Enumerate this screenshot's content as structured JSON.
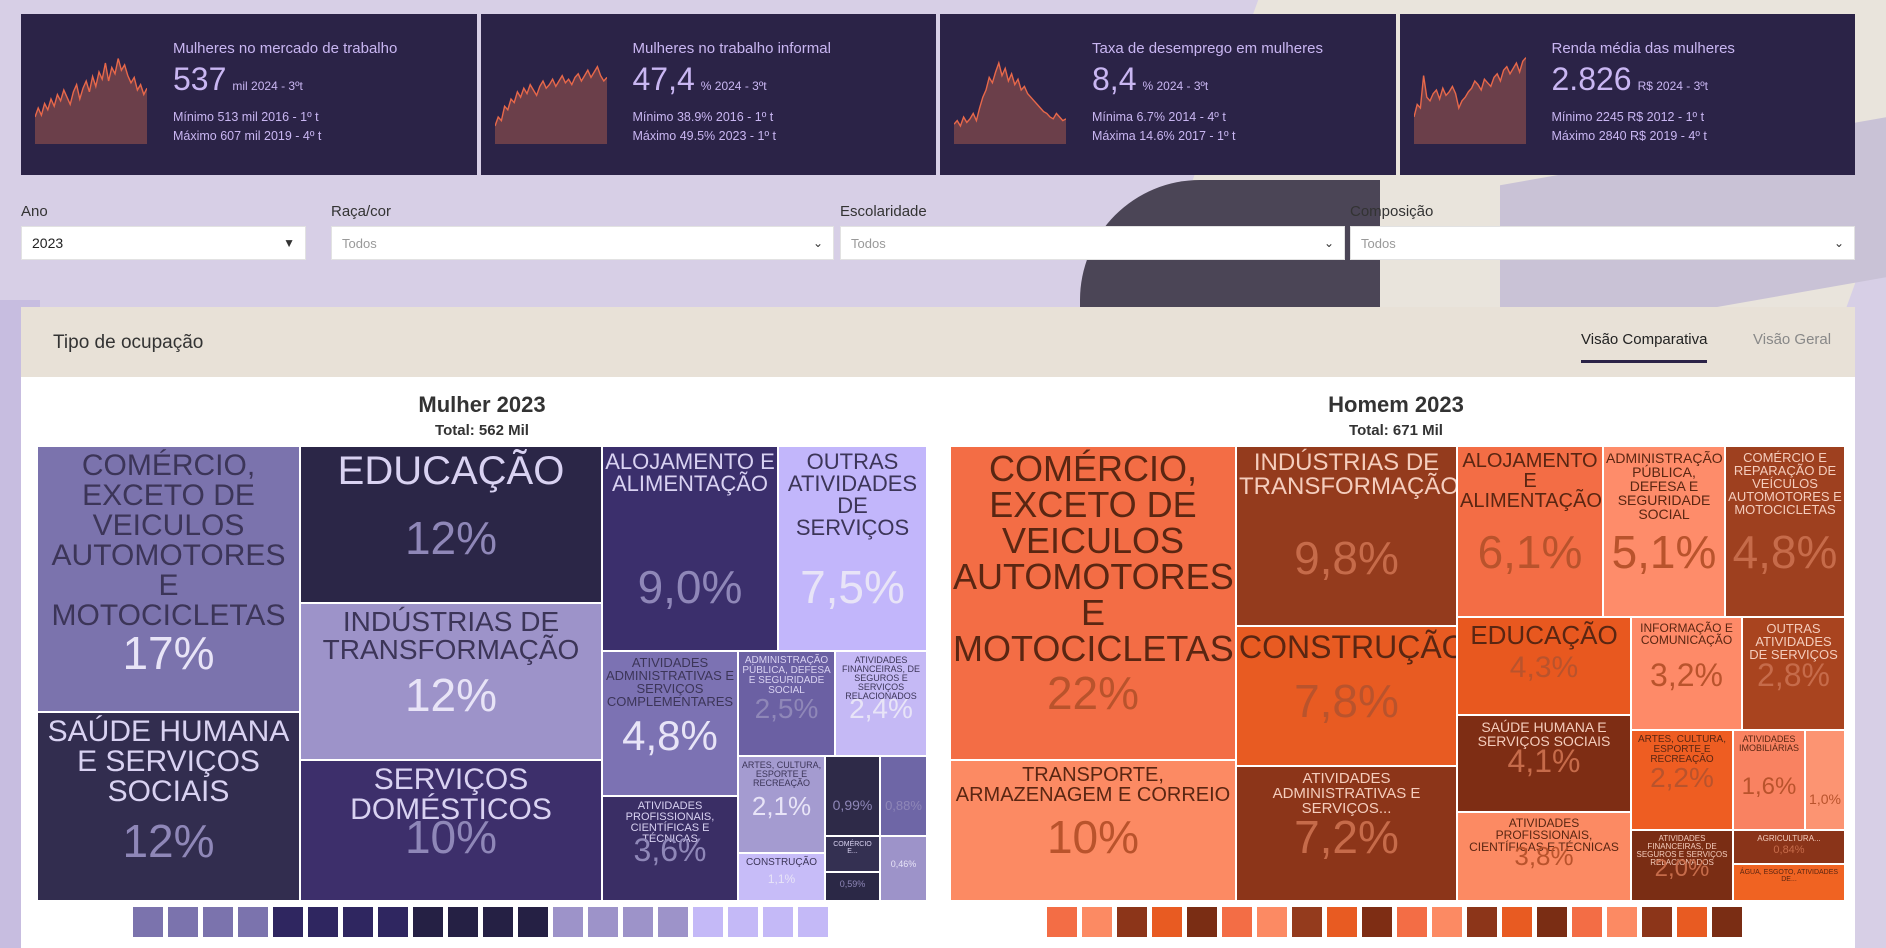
{
  "kpis": [
    {
      "title": "Mulheres no mercado de trabalho",
      "value": "537",
      "unit": "mil 2024 - 3ºt",
      "min": "Mínimo 513 mil 2016 - 1º t",
      "max": "Máximo 607 mil 2019 - 4º t",
      "spark": [
        30,
        40,
        32,
        45,
        38,
        50,
        42,
        55,
        48,
        60,
        52,
        44,
        58,
        66,
        50,
        62,
        70,
        58,
        75,
        64,
        80,
        72,
        90,
        70,
        85,
        78,
        95,
        82,
        88,
        76,
        68,
        74,
        60,
        66,
        55,
        62
      ]
    },
    {
      "title": "Mulheres no trabalho informal",
      "value": "47,4",
      "unit": "% 2024 - 3ºt",
      "min": "Mínimo 38.9% 2016 - 1º t",
      "max": "Máximo 49.5% 2023 - 1º t",
      "spark": [
        20,
        30,
        26,
        42,
        38,
        50,
        46,
        58,
        52,
        62,
        56,
        66,
        60,
        54,
        64,
        70,
        62,
        66,
        72,
        64,
        70,
        76,
        68,
        72,
        66,
        74,
        78,
        70,
        76,
        82,
        74,
        80,
        86,
        76,
        70,
        74
      ]
    },
    {
      "title": "Taxa de desemprego em mulheres",
      "value": "8,4",
      "unit": "% 2024 - 3ºt",
      "min": "Mínima 6.7% 2014 - 4º t",
      "max": "Máxima 14.6% 2017 - 1º t",
      "spark": [
        22,
        26,
        20,
        30,
        24,
        28,
        34,
        26,
        40,
        52,
        60,
        74,
        68,
        80,
        90,
        76,
        84,
        70,
        78,
        66,
        72,
        60,
        64,
        56,
        52,
        48,
        44,
        40,
        36,
        34,
        30,
        28,
        34,
        30,
        26,
        28
      ]
    },
    {
      "title": "Renda média das mulheres",
      "value": "2.826",
      "unit": "R$ 2024 - 3ºt",
      "min": "Mínimo 2245 R$ 2012 - 1º t",
      "max": "Máximo 2840 R$ 2019 - 4º t",
      "spark": [
        30,
        44,
        40,
        76,
        52,
        48,
        56,
        60,
        50,
        62,
        54,
        58,
        64,
        56,
        40,
        48,
        52,
        58,
        62,
        70,
        66,
        60,
        72,
        68,
        64,
        74,
        78,
        70,
        82,
        86,
        78,
        84,
        90,
        80,
        92,
        96
      ]
    }
  ],
  "filters": {
    "ano": {
      "label": "Ano",
      "value": "2023"
    },
    "raca": {
      "label": "Raça/cor",
      "placeholder": "Todos"
    },
    "escolaridade": {
      "label": "Escolaridade",
      "placeholder": "Todos"
    },
    "composicao": {
      "label": "Composição",
      "placeholder": "Todos"
    }
  },
  "panel": {
    "title": "Tipo de ocupação",
    "tabs": [
      {
        "label": "Visão Comparativa",
        "active": true
      },
      {
        "label": "Visão Geral",
        "active": false
      }
    ]
  },
  "charts": {
    "mulher": {
      "title": "Mulher 2023",
      "subtitle": "Total: 562 Mil"
    },
    "homem": {
      "title": "Homem 2023",
      "subtitle": "Total: 671 Mil"
    }
  },
  "chart_data": [
    {
      "type": "treemap",
      "title": "Mulher 2023",
      "subtitle": "Total: 562 Mil",
      "items": [
        {
          "label": "Comércio, exceto de veiculos automotores e motocicletas",
          "pct": "17%",
          "color": "#7b73ad"
        },
        {
          "label": "Saúde humana e serviços sociais",
          "pct": "12%",
          "color": "#322d4f"
        },
        {
          "label": "Educação",
          "pct": "12%",
          "color": "#2b2647"
        },
        {
          "label": "Indústrias de transformação",
          "pct": "12%",
          "color": "#9d93c9"
        },
        {
          "label": "Serviços domésticos",
          "pct": "10%",
          "color": "#3d2f6b"
        },
        {
          "label": "Alojamento e alimentação",
          "pct": "9,0%",
          "color": "#3b2f6c"
        },
        {
          "label": "Outras atividades de serviços",
          "pct": "7,5%",
          "color": "#c2b6fb"
        },
        {
          "label": "Atividades administrativas e serviços complementares",
          "pct": "4,8%",
          "color": "#7c72b3"
        },
        {
          "label": "Administração pública, defesa e seguridade social",
          "pct": "2,5%",
          "color": "#6b60a3"
        },
        {
          "label": "Atividades financeiras, de seguros e serviços relacionados",
          "pct": "2,4%",
          "color": "#c5b9f5"
        },
        {
          "label": "Atividades profissionais, científicas e técnicas",
          "pct": "3,6%",
          "color": "#3a2e65"
        },
        {
          "label": "Artes, cultura, esporte e recreação",
          "pct": "2,1%",
          "color": "#a49bd0"
        },
        {
          "label": "Construção",
          "pct": "1,1%",
          "color": "#c7bcf8"
        },
        {
          "label": "",
          "pct": "0,99%",
          "color": "#2e2a48"
        },
        {
          "label": "",
          "pct": "0,88%",
          "color": "#6e66a6"
        },
        {
          "label": "Comércio e...",
          "pct": "",
          "color": "#343052"
        },
        {
          "label": "",
          "pct": "0,59%",
          "color": "#2b2846"
        },
        {
          "label": "",
          "pct": "0,46%",
          "color": "#9d93c9"
        }
      ]
    },
    {
      "type": "treemap",
      "title": "Homem 2023",
      "subtitle": "Total: 671 Mil",
      "items": [
        {
          "label": "Comércio, exceto de veiculos automotores e motocicletas",
          "pct": "22%",
          "color": "#f36d45"
        },
        {
          "label": "Transporte, armazenagem e correio",
          "pct": "10%",
          "color": "#fc8a63"
        },
        {
          "label": "Indústrias de transformação",
          "pct": "9,8%",
          "color": "#943b1d"
        },
        {
          "label": "Construção",
          "pct": "7,8%",
          "color": "#e85b22"
        },
        {
          "label": "Atividades administrativas e serviços...",
          "pct": "7,2%",
          "color": "#8c3519"
        },
        {
          "label": "Alojamento e alimentação",
          "pct": "6,1%",
          "color": "#f36d45"
        },
        {
          "label": "Administração pública, defesa e seguridade social",
          "pct": "5,1%",
          "color": "#fe8c6a"
        },
        {
          "label": "Comércio e reparação de veículos automotores e motocicletas",
          "pct": "4,8%",
          "color": "#9e401f"
        },
        {
          "label": "Educação",
          "pct": "4,3%",
          "color": "#e8581f"
        },
        {
          "label": "Informação e comunicação",
          "pct": "3,2%",
          "color": "#fe8a68"
        },
        {
          "label": "Outras atividades de serviços",
          "pct": "2,8%",
          "color": "#a9441f"
        },
        {
          "label": "Saúde humana e serviços sociais",
          "pct": "4,1%",
          "color": "#7e2d14"
        },
        {
          "label": "Atividades profissionais, científicas e técnicas",
          "pct": "3,8%",
          "color": "#fc8a63"
        },
        {
          "label": "Artes, cultura, esporte e recreação",
          "pct": "2,2%",
          "color": "#ee5d22"
        },
        {
          "label": "Atividades imobiliárias",
          "pct": "1,6%",
          "color": "#f98261"
        },
        {
          "label": "",
          "pct": "1,0%",
          "color": "#fc9472"
        },
        {
          "label": "Atividades financeiras, de seguros e serviços relacionados",
          "pct": "2,0%",
          "color": "#7a2d14"
        },
        {
          "label": "Agricultura...",
          "pct": "0,84%",
          "color": "#8a3419"
        },
        {
          "label": "Água, esgoto, atividades de...",
          "pct": "",
          "color": "#f06322"
        }
      ]
    }
  ],
  "legends": {
    "mulher": [
      "#7b73ad",
      "#7b73ad",
      "#7b73ad",
      "#7b73ad",
      "#2f2660",
      "#2f2660",
      "#2f2660",
      "#2f2660",
      "#252044",
      "#252044",
      "#252044",
      "#252044",
      "#9d93c9",
      "#9d93c9",
      "#9d93c9",
      "#9d93c9",
      "#c4b9f7",
      "#c4b9f7",
      "#c4b9f7",
      "#c4b9f7"
    ],
    "homem": [
      "#f36d45",
      "#fc8a63",
      "#8c3519",
      "#e85b22",
      "#7a2d14",
      "#f36d45",
      "#fc8a63",
      "#943b1d",
      "#e85b22",
      "#7e2d14",
      "#f36d45",
      "#fc8a63",
      "#8c3519",
      "#e85b22",
      "#7a2d14",
      "#f36d45",
      "#fc8a63",
      "#8c3519",
      "#e85b22",
      "#7a2d14"
    ]
  }
}
